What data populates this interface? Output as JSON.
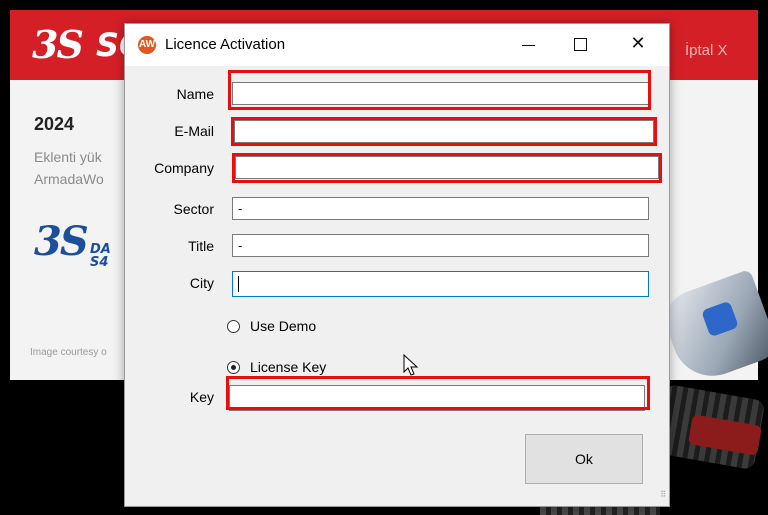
{
  "splash": {
    "brand": "SO",
    "cancel": "İptal X",
    "year": "2024",
    "line1": "Eklenti yük",
    "line2": "ArmadaWo",
    "ds_text_1": "DA",
    "ds_text_2": "S4",
    "credit": "Image courtesy o"
  },
  "dialog": {
    "title": "Licence Activation",
    "icon_text": "AW",
    "fields": {
      "name": {
        "label": "Name",
        "value": ""
      },
      "email": {
        "label": "E-Mail",
        "value": ""
      },
      "company": {
        "label": "Company",
        "value": ""
      },
      "sector": {
        "label": "Sector",
        "value": "-"
      },
      "title": {
        "label": "Title",
        "value": "-"
      },
      "city": {
        "label": "City",
        "value": ""
      },
      "key": {
        "label": "Key",
        "value": ""
      }
    },
    "options": {
      "use_demo": {
        "label": "Use Demo",
        "selected": false
      },
      "license_key": {
        "label": "License Key",
        "selected": true
      }
    },
    "ok_label": "Ok"
  },
  "colors": {
    "highlight": "#ea0d0d",
    "splash_red": "#d51f26",
    "ds_blue": "#1c4e9a",
    "focus_border": "#0078d7"
  },
  "icons": [
    "minimize-icon",
    "maximize-icon",
    "close-icon",
    "app-icon",
    "mouse-cursor-icon"
  ]
}
